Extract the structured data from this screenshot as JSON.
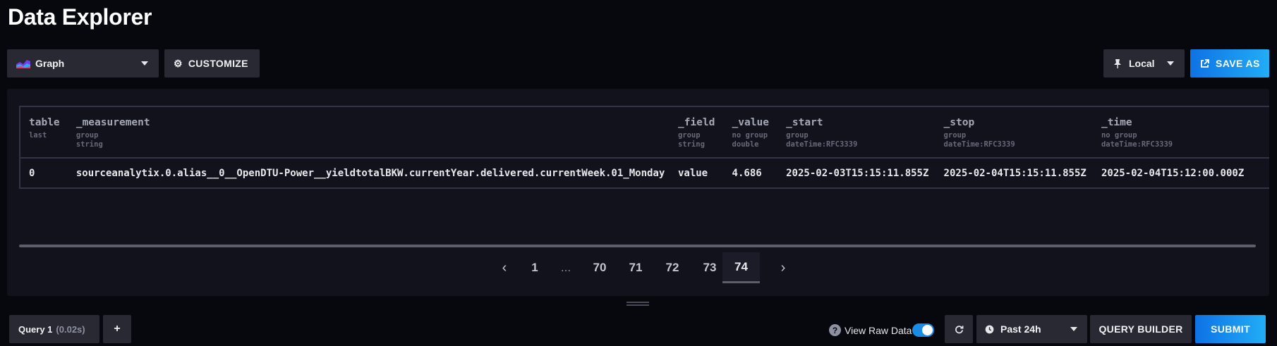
{
  "header": {
    "title": "Data Explorer"
  },
  "toolbar": {
    "graph_type_label": "Graph",
    "customize_label": "CUSTOMIZE",
    "timezone_label": "Local",
    "save_as_label": "SAVE AS"
  },
  "table": {
    "columns": [
      {
        "name": "table",
        "meta1": "last",
        "meta2": ""
      },
      {
        "name": "_measurement",
        "meta1": "group",
        "meta2": "string"
      },
      {
        "name": "_field",
        "meta1": "group",
        "meta2": "string"
      },
      {
        "name": "_value",
        "meta1": "no group",
        "meta2": "double"
      },
      {
        "name": "_start",
        "meta1": "group",
        "meta2": "dateTime:RFC3339"
      },
      {
        "name": "_stop",
        "meta1": "group",
        "meta2": "dateTime:RFC3339"
      },
      {
        "name": "_time",
        "meta1": "no group",
        "meta2": "dateTime:RFC3339"
      }
    ],
    "rows": [
      [
        "0",
        "sourceanalytix.0.alias__0__OpenDTU-Power__yieldtotalBKW.currentYear.delivered.currentWeek.01_Monday",
        "value",
        "4.686",
        "2025-02-03T15:15:11.855Z",
        "2025-02-04T15:15:11.855Z",
        "2025-02-04T15:12:00.000Z"
      ]
    ]
  },
  "pagination": {
    "pages": [
      "1",
      "...",
      "70",
      "71",
      "72",
      "73",
      "74"
    ],
    "active": "74",
    "prev_glyph": "‹",
    "next_glyph": "›"
  },
  "footer": {
    "query_tab_label": "Query 1",
    "query_tab_time": "(0.02s)",
    "add_query_glyph": "+",
    "help_glyph": "?",
    "view_raw_label": "View Raw Data",
    "view_raw_enabled": true,
    "time_range_label": "Past 24h",
    "query_builder_label": "QUERY BUILDER",
    "submit_label": "SUBMIT"
  },
  "colors": {
    "accent_blue": "#1b8ce5",
    "background": "#07070e",
    "panel": "#12121c",
    "button_dark": "#292933"
  }
}
